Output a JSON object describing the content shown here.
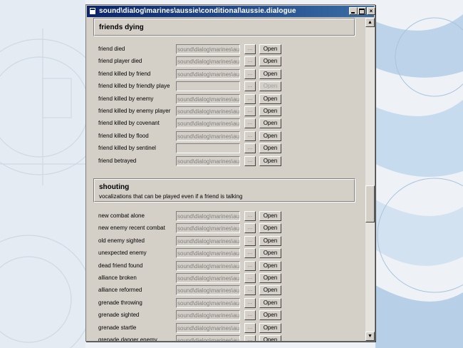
{
  "window": {
    "title": "sound\\dialog\\marines\\aussie\\conditional\\aussie.dialogue",
    "controls": {
      "minimize": "_",
      "maximize": "□",
      "close": "×"
    }
  },
  "icons": {
    "browse": "...",
    "scroll_up": "▲",
    "scroll_down": "▼"
  },
  "sections": {
    "friends_dying": {
      "title": "friends dying",
      "rows": [
        {
          "label": "friend died",
          "path": "sound\\dialog\\marines\\aus",
          "open": "Open",
          "open_enabled": true
        },
        {
          "label": "friend player died",
          "path": "sound\\dialog\\marines\\aus",
          "open": "Open",
          "open_enabled": true
        },
        {
          "label": "friend killed by friend",
          "path": "sound\\dialog\\marines\\aus",
          "open": "Open",
          "open_enabled": true
        },
        {
          "label": "friend killed by friendly playe",
          "path": "",
          "open": "Open",
          "open_enabled": false
        },
        {
          "label": "friend killed by enemy",
          "path": "sound\\dialog\\marines\\aus",
          "open": "Open",
          "open_enabled": true
        },
        {
          "label": "friend killed by enemy player",
          "path": "sound\\dialog\\marines\\aus",
          "open": "Open",
          "open_enabled": true
        },
        {
          "label": "friend killed by covenant",
          "path": "sound\\dialog\\marines\\aus",
          "open": "Open",
          "open_enabled": true
        },
        {
          "label": "friend killed by flood",
          "path": "sound\\dialog\\marines\\aus",
          "open": "Open",
          "open_enabled": true
        },
        {
          "label": "friend killed by sentinel",
          "path": "",
          "open": "Open",
          "open_enabled": true
        },
        {
          "label": "friend betrayed",
          "path": "sound\\dialog\\marines\\aus",
          "open": "Open",
          "open_enabled": true
        }
      ]
    },
    "shouting": {
      "title": "shouting",
      "description": "vocalizations that can be played even if a friend is talking",
      "rows": [
        {
          "label": "new combat alone",
          "path": "sound\\dialog\\marines\\aus",
          "open": "Open",
          "open_enabled": true
        },
        {
          "label": "new enemy recent combat",
          "path": "sound\\dialog\\marines\\aus",
          "open": "Open",
          "open_enabled": true
        },
        {
          "label": "old enemy sighted",
          "path": "sound\\dialog\\marines\\aus",
          "open": "Open",
          "open_enabled": true
        },
        {
          "label": "unexpected enemy",
          "path": "sound\\dialog\\marines\\aus",
          "open": "Open",
          "open_enabled": true
        },
        {
          "label": "dead friend found",
          "path": "sound\\dialog\\marines\\aus",
          "open": "Open",
          "open_enabled": true
        },
        {
          "label": "alliance broken",
          "path": "sound\\dialog\\marines\\aus",
          "open": "Open",
          "open_enabled": true
        },
        {
          "label": "alliance reformed",
          "path": "sound\\dialog\\marines\\aus",
          "open": "Open",
          "open_enabled": true
        },
        {
          "label": "grenade throwing",
          "path": "sound\\dialog\\marines\\aus",
          "open": "Open",
          "open_enabled": true
        },
        {
          "label": "grenade sighted",
          "path": "sound\\dialog\\marines\\aus",
          "open": "Open",
          "open_enabled": true
        },
        {
          "label": "grenade startle",
          "path": "sound\\dialog\\marines\\aus",
          "open": "Open",
          "open_enabled": true
        },
        {
          "label": "grenade danger enemy",
          "path": "sound\\dialog\\marines\\aus",
          "open": "Open",
          "open_enabled": true
        }
      ]
    }
  }
}
